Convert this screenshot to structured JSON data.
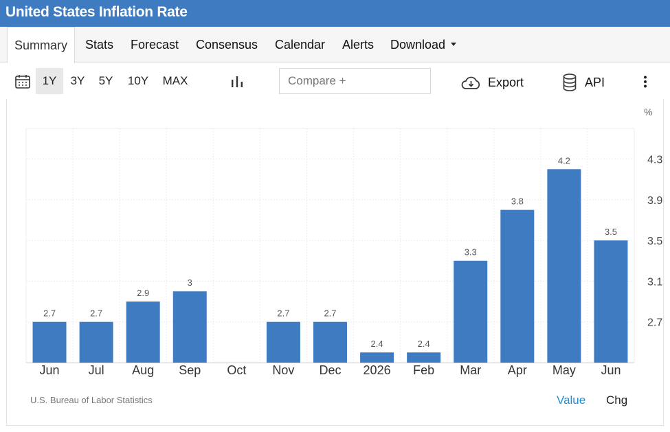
{
  "header": {
    "title": "United States Inflation Rate"
  },
  "tabs": [
    {
      "label": "Summary",
      "active": true
    },
    {
      "label": "Stats"
    },
    {
      "label": "Forecast"
    },
    {
      "label": "Consensus"
    },
    {
      "label": "Calendar"
    },
    {
      "label": "Alerts"
    },
    {
      "label": "Download",
      "has_dropdown": true
    }
  ],
  "toolbar": {
    "ranges": [
      {
        "label": "1Y",
        "active": true
      },
      {
        "label": "3Y"
      },
      {
        "label": "5Y"
      },
      {
        "label": "10Y"
      },
      {
        "label": "MAX"
      }
    ],
    "compare_placeholder": "Compare +",
    "export_label": "Export",
    "api_label": "API",
    "icons": [
      "calendar-icon",
      "bar-chart-icon",
      "cloud-download-icon",
      "database-icon",
      "more-vertical-icon"
    ]
  },
  "chart_data": {
    "type": "bar",
    "unit_label": "%",
    "categories": [
      "Jun",
      "Jul",
      "Aug",
      "Sep",
      "Oct",
      "Nov",
      "Dec",
      "2026",
      "Feb",
      "Mar",
      "Apr",
      "May",
      "Jun"
    ],
    "values": [
      2.7,
      2.7,
      2.9,
      3.0,
      null,
      2.7,
      2.7,
      2.4,
      2.4,
      3.3,
      3.8,
      4.2,
      3.5
    ],
    "value_labels": [
      "2.7",
      "2.7",
      "2.9",
      "3",
      "",
      "2.7",
      "2.7",
      "2.4",
      "2.4",
      "3.3",
      "3.8",
      "4.2",
      "3.5"
    ],
    "y_ticks": [
      "2.7",
      "3.1",
      "3.5",
      "3.9",
      "4.3"
    ],
    "ylim": [
      2.3,
      4.6
    ],
    "grid": true,
    "y_axis_side": "right",
    "bar_color": "#3f7bc1"
  },
  "footer": {
    "source": "U.S. Bureau of Labor Statistics",
    "toggle_value": "Value",
    "toggle_chg": "Chg",
    "active_color": "#1a8fd3"
  }
}
